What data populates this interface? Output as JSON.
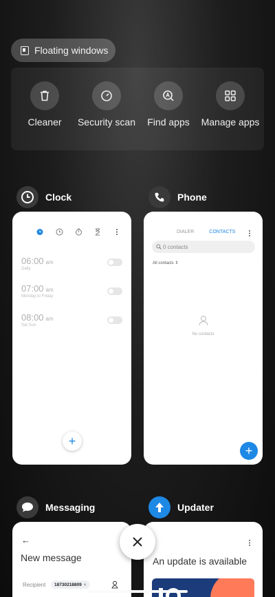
{
  "floating_windows": {
    "label": "Floating windows"
  },
  "tools": [
    {
      "label": "Cleaner",
      "icon": "trash-icon"
    },
    {
      "label": "Security scan",
      "icon": "security-gauge-icon"
    },
    {
      "label": "Find apps",
      "icon": "find-apps-icon"
    },
    {
      "label": "Manage apps",
      "icon": "grid-icon"
    }
  ],
  "apps": {
    "clock": {
      "name": "Clock",
      "alarms": [
        {
          "time": "06:00",
          "ampm": "am",
          "sub": "Daily"
        },
        {
          "time": "07:00",
          "ampm": "am",
          "sub": "Monday to Friday"
        },
        {
          "time": "08:00",
          "ampm": "am",
          "sub": "Sat Sun"
        }
      ],
      "add_label": "+"
    },
    "phone": {
      "name": "Phone",
      "tab_dialer": "DIALER",
      "tab_contacts": "CONTACTS",
      "search_placeholder": "0 contacts",
      "filter": "All contacts",
      "empty": "No contacts",
      "add_label": "+"
    },
    "messaging": {
      "name": "Messaging",
      "title": "New message",
      "recipient_label": "Recipient",
      "recipient_value": "18730218809"
    },
    "updater": {
      "name": "Updater",
      "title": "An update is available"
    }
  },
  "colors": {
    "accent": "#1e88e5",
    "updater_orange": "#ff7a59",
    "updater_navy": "#1c3b7a"
  }
}
